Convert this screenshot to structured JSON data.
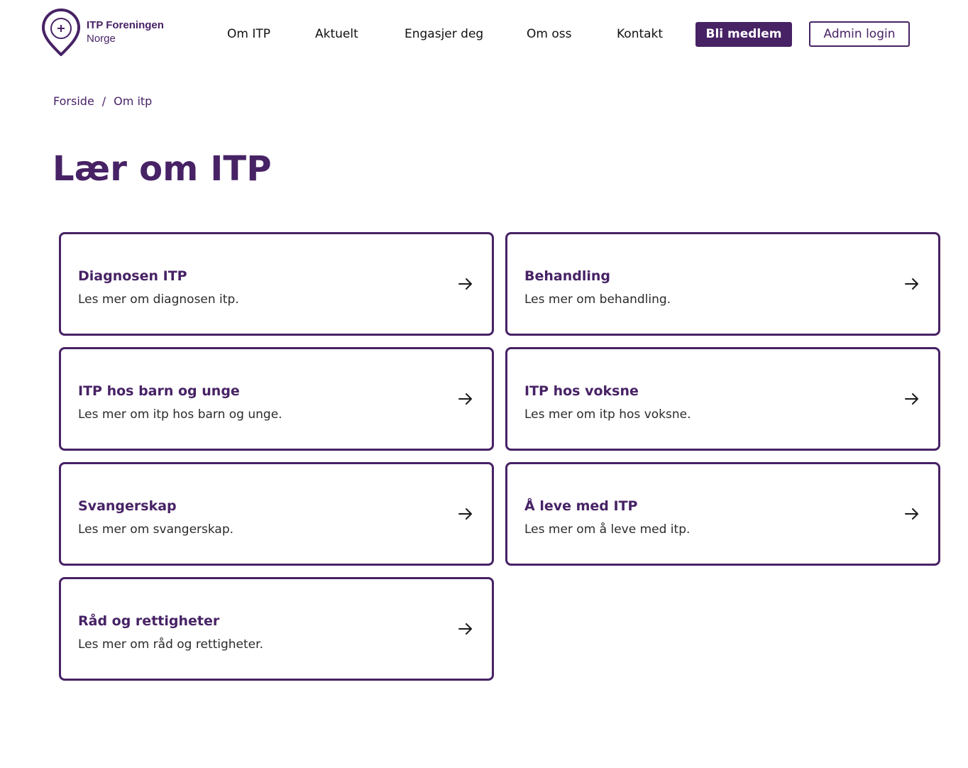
{
  "brand": {
    "name_line1": "ITP Foreningen",
    "name_line2": "Norge",
    "color": "#472265"
  },
  "nav": {
    "items": [
      {
        "label": "Om ITP"
      },
      {
        "label": "Aktuelt"
      },
      {
        "label": "Engasjer deg"
      },
      {
        "label": "Om oss"
      },
      {
        "label": "Kontakt"
      }
    ],
    "cta_label": "Bli medlem",
    "admin_label": "Admin login"
  },
  "breadcrumb": {
    "items": [
      "Forside",
      "Om itp"
    ],
    "separator": "/"
  },
  "page": {
    "title": "Lær om ITP"
  },
  "cards": [
    {
      "title": "Diagnosen ITP",
      "description": "Les mer om diagnosen itp.",
      "icon": "arrow-right-icon"
    },
    {
      "title": "Behandling",
      "description": "Les mer om behandling.",
      "icon": "arrow-right-icon"
    },
    {
      "title": "ITP hos barn og unge",
      "description": "Les mer om itp hos barn og unge.",
      "icon": "arrow-right-icon"
    },
    {
      "title": "ITP hos voksne",
      "description": "Les mer om itp hos voksne.",
      "icon": "arrow-right-icon"
    },
    {
      "title": "Svangerskap",
      "description": "Les mer om svangerskap.",
      "icon": "arrow-right-icon"
    },
    {
      "title": "Å leve med ITP",
      "description": "Les mer om å leve med itp.",
      "icon": "arrow-right-icon"
    },
    {
      "title": "Råd og rettigheter",
      "description": "Les mer om råd og rettigheter.",
      "icon": "arrow-right-icon"
    }
  ]
}
